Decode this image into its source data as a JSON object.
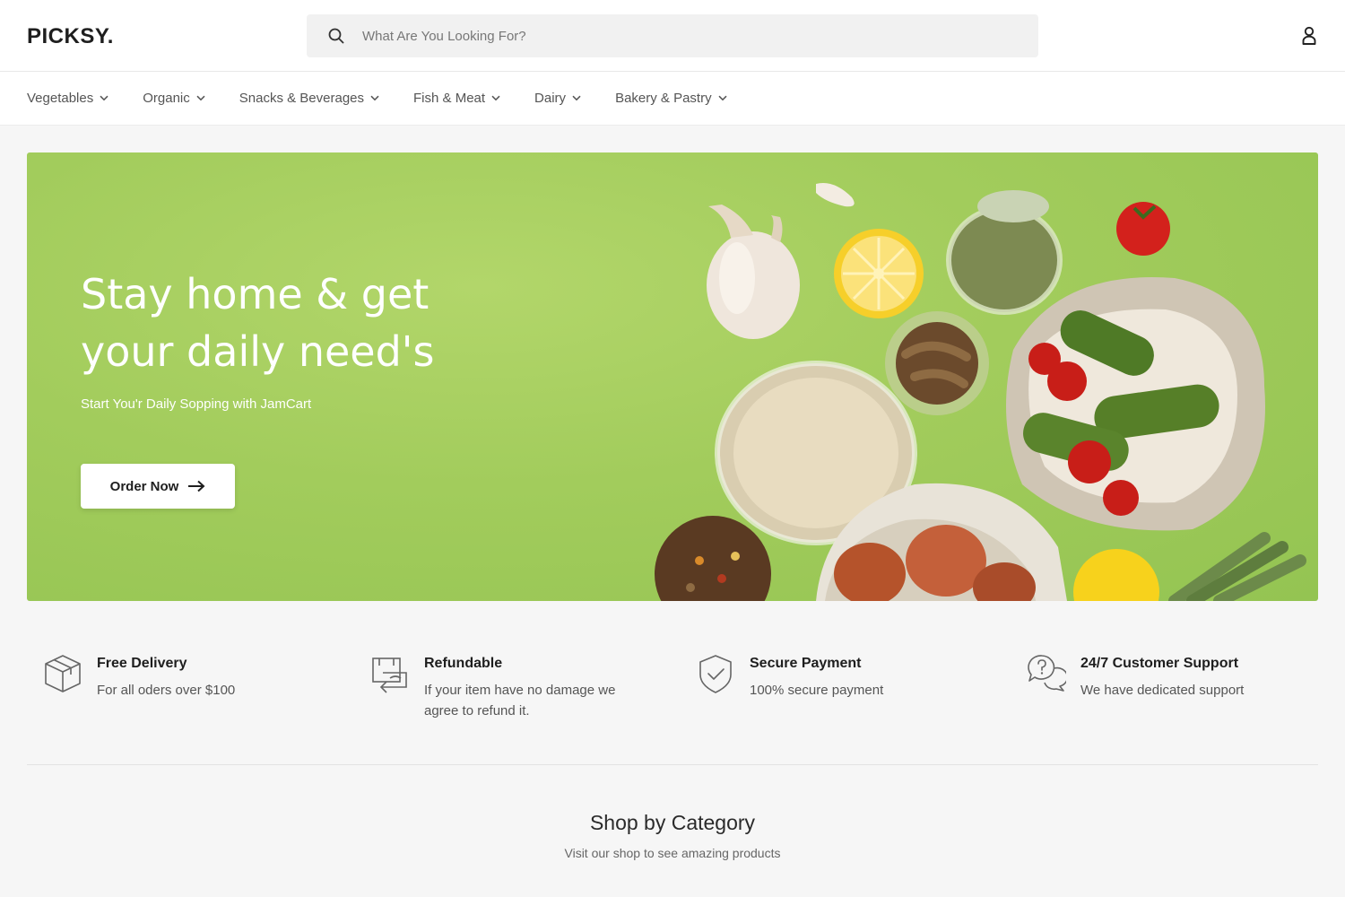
{
  "header": {
    "logo": "PICKSY.",
    "search_placeholder": "What Are You Looking For?"
  },
  "nav": {
    "items": [
      {
        "label": "Vegetables"
      },
      {
        "label": "Organic"
      },
      {
        "label": "Snacks & Beverages"
      },
      {
        "label": "Fish & Meat"
      },
      {
        "label": "Dairy"
      },
      {
        "label": "Bakery & Pastry"
      }
    ]
  },
  "hero": {
    "title": "Stay home & get your daily need's",
    "subtitle": "Start You'r Daily Sopping with JamCart",
    "button_label": "Order Now"
  },
  "features": [
    {
      "title": "Free Delivery",
      "desc": "For all oders over $100",
      "icon": "box-icon"
    },
    {
      "title": "Refundable",
      "desc": "If your item have no damage we agree to refund it.",
      "icon": "refund-icon"
    },
    {
      "title": "Secure Payment",
      "desc": "100% secure payment",
      "icon": "shield-icon"
    },
    {
      "title": "24/7 Customer Support",
      "desc": "We have dedicated support",
      "icon": "support-chat-icon"
    }
  ],
  "category_section": {
    "title": "Shop by Category",
    "subtitle": "Visit our shop to see amazing products"
  },
  "colors": {
    "hero_green": "#a2cc5c",
    "text_dark": "#1e1e1e",
    "search_bg": "#f1f1f1"
  }
}
